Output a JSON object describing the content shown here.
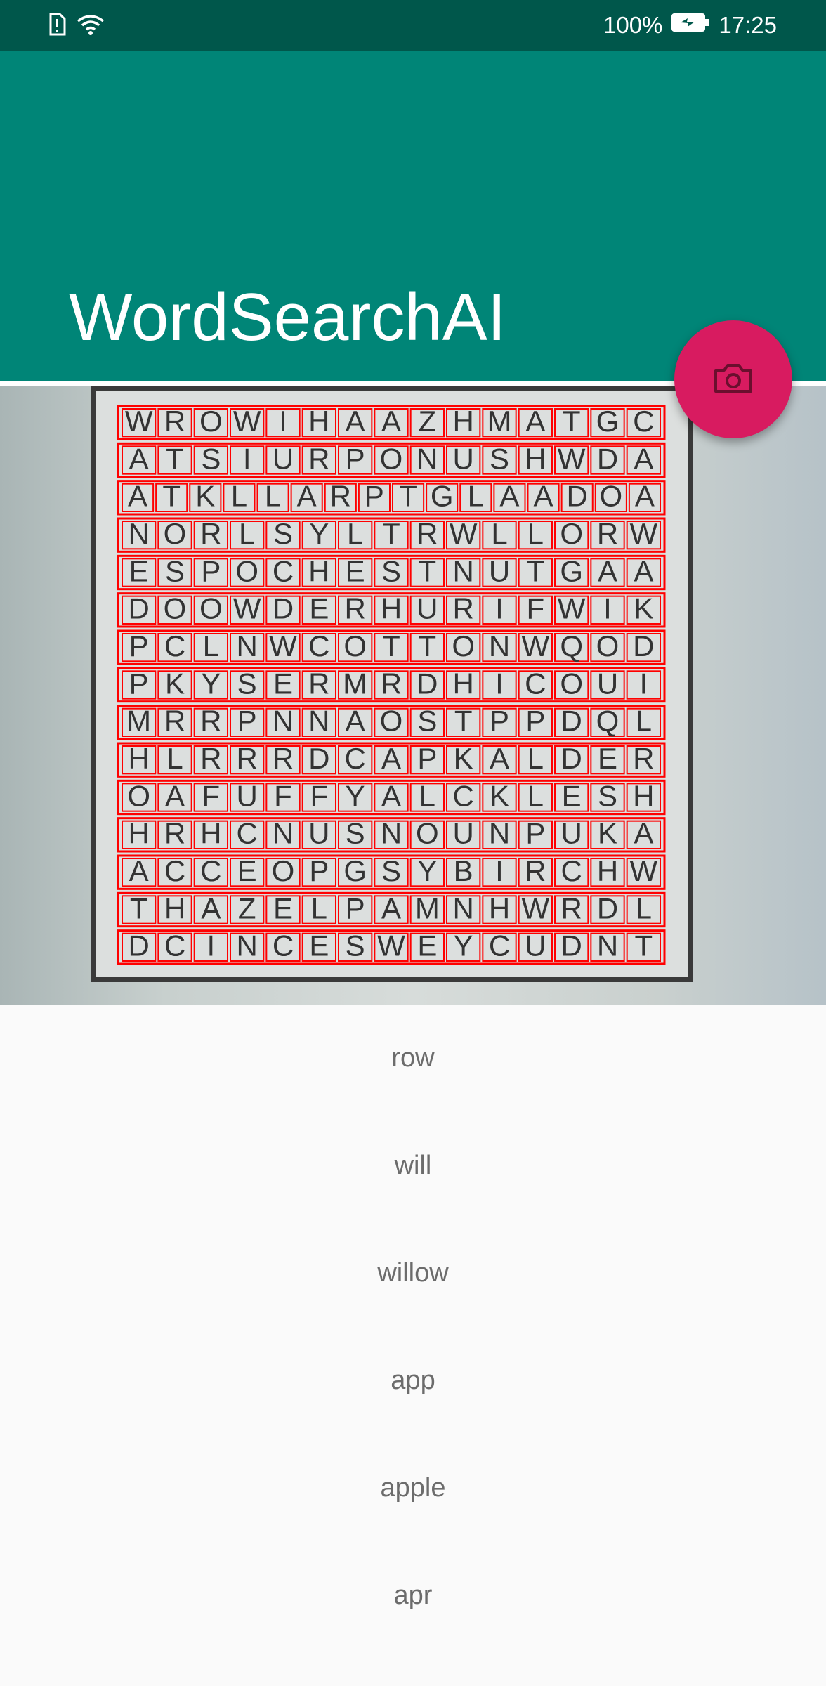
{
  "status_bar": {
    "battery_percent": "100%",
    "time": "17:25",
    "icons": [
      "sim-alert-icon",
      "wifi-icon",
      "battery-charging-icon"
    ]
  },
  "app_bar": {
    "title": "WordSearchAI",
    "accent_color": "#008577",
    "dark_color": "#00574b"
  },
  "fab": {
    "icon": "camera-icon",
    "color": "#d81b60"
  },
  "puzzle_grid": {
    "rows": [
      "WROWIHAAZHMATGC",
      "ATSIURPONUSHWDA",
      "ATKLLARPTGLAADOA",
      "NORLSYLTRWLLORW",
      "ESPOCHESTNUTGAA",
      "DOOWDERHURIFWIK",
      "PCLNWCOTTONWQOD",
      "PKYSERMRDHICOUI",
      "MRRPNNAOSTPPDQL",
      "HLRRRDCAPKALDER",
      "OAFUFFYALCKLESH",
      "HRHCNUSNOUNPUKA",
      "ACCEOPGSYBIRCHW",
      "THAZELPAMNHWRDL",
      "DCINCESWEYCUDNT"
    ],
    "highlight_color": "#ff0000"
  },
  "word_list": [
    "row",
    "will",
    "willow",
    "app",
    "apple",
    "apr"
  ]
}
